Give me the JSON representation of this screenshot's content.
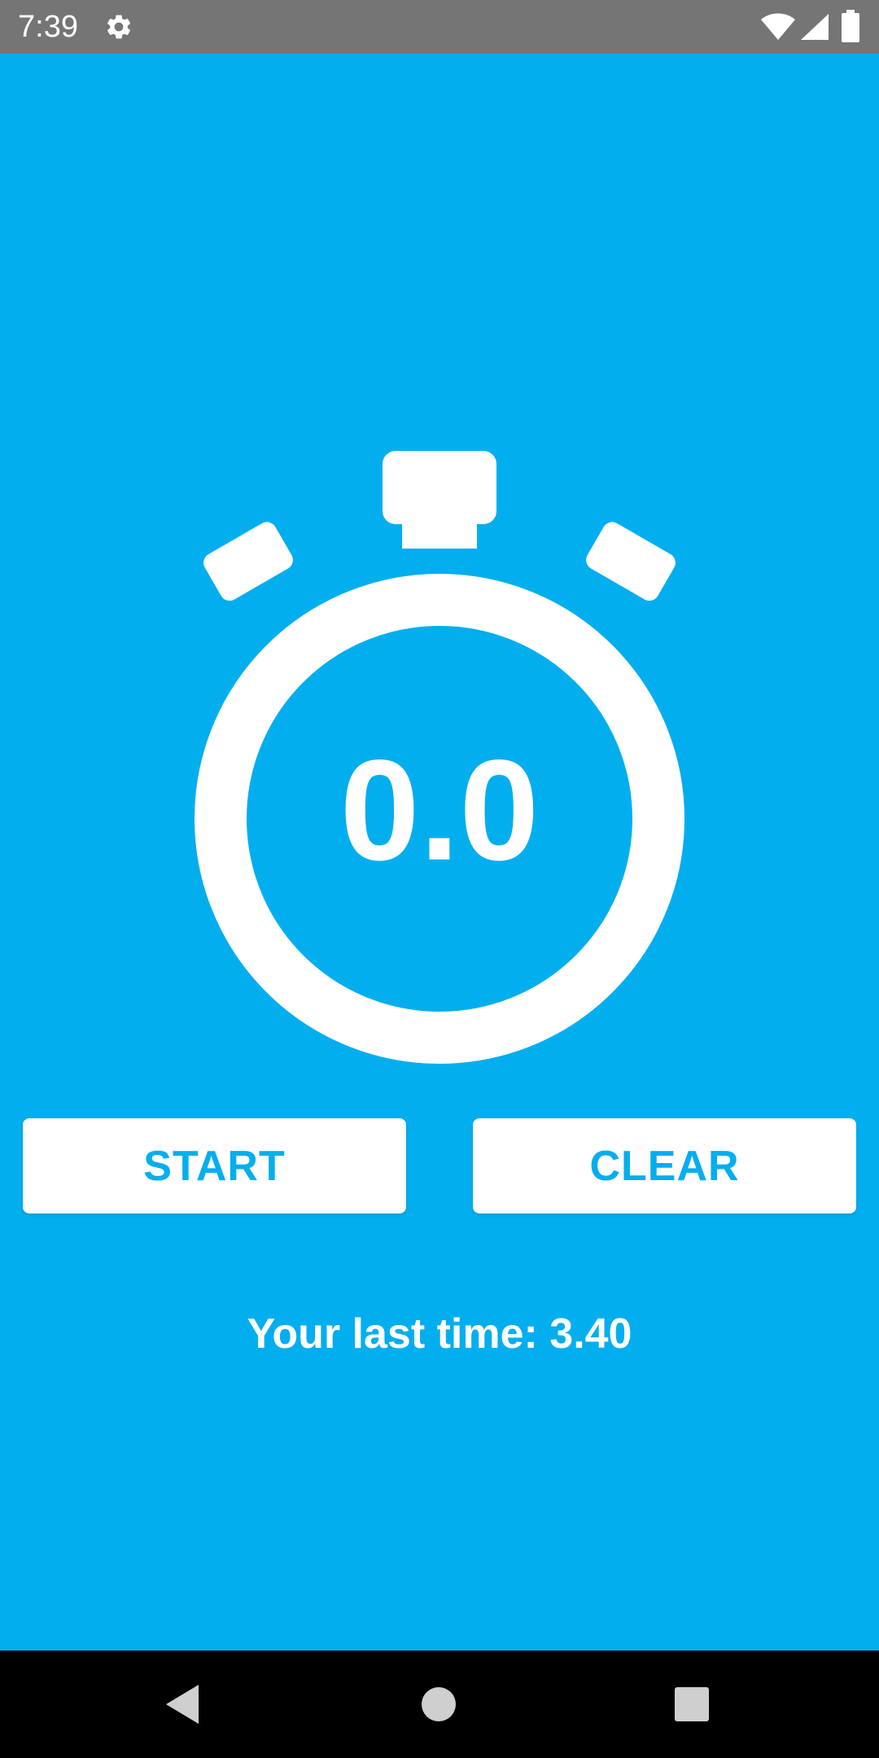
{
  "status_bar": {
    "time": "7:39",
    "icons": [
      "gear-icon",
      "wifi-icon",
      "signal-icon",
      "battery-icon"
    ],
    "background": "#757575"
  },
  "app": {
    "background": "#03AEEF",
    "accent": "#03AEEF",
    "timer_value": "0.0",
    "start_label": "START",
    "clear_label": "CLEAR",
    "last_time_text": "Your last time: 3.40",
    "graphic_icon": "stopwatch-icon"
  },
  "nav_bar": {
    "icons": [
      "back-icon",
      "home-icon",
      "recents-icon"
    ],
    "background": "#000000"
  }
}
